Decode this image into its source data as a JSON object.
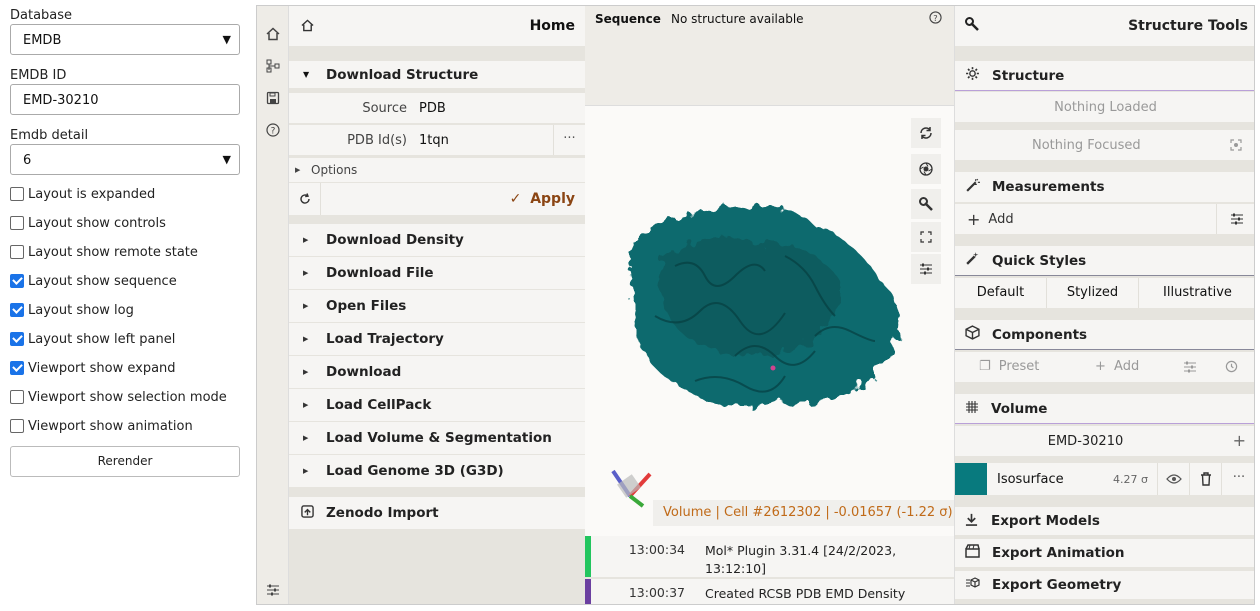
{
  "left": {
    "database_label": "Database",
    "database_value": "EMDB",
    "emdb_id_label": "EMDB ID",
    "emdb_id_value": "EMD-30210",
    "detail_label": "Emdb detail",
    "detail_value": "6",
    "checkboxes": [
      {
        "label": "Layout is expanded",
        "checked": false
      },
      {
        "label": "Layout show controls",
        "checked": false
      },
      {
        "label": "Layout show remote state",
        "checked": false
      },
      {
        "label": "Layout show sequence",
        "checked": true
      },
      {
        "label": "Layout show log",
        "checked": true
      },
      {
        "label": "Layout show left panel",
        "checked": true
      },
      {
        "label": "Viewport show expand",
        "checked": true
      },
      {
        "label": "Viewport show selection mode",
        "checked": false
      },
      {
        "label": "Viewport show animation",
        "checked": false
      }
    ],
    "rerender": "Rerender"
  },
  "home": {
    "title": "Home",
    "download_structure": "Download Structure",
    "source_label": "Source",
    "source_value": "PDB",
    "pdbid_label": "PDB Id(s)",
    "pdbid_value": "1tqn",
    "options": "Options",
    "apply": "Apply",
    "sections": [
      "Download Density",
      "Download File",
      "Open Files",
      "Load Trajectory",
      "Download",
      "Load CellPack",
      "Load Volume & Segmentation",
      "Load Genome 3D (G3D)"
    ],
    "zenodo": "Zenodo Import"
  },
  "sequence": {
    "label": "Sequence",
    "status": "No structure available"
  },
  "viewport": {
    "readout": "Volume | Cell #2612302 | -0.01657 (-1.22 σ)"
  },
  "log": [
    {
      "time": "13:00:34",
      "message": "Mol* Plugin 3.31.4 [24/2/2023, 13:12:10]",
      "color": "#22c55e"
    },
    {
      "time": "13:00:37",
      "message": "Created RCSB PDB EMD Density",
      "color": "#6b3fa0"
    }
  ],
  "tools": {
    "title": "Structure Tools",
    "structure": "Structure",
    "nothing_loaded": "Nothing Loaded",
    "nothing_focused": "Nothing Focused",
    "measurements": "Measurements",
    "add": "Add",
    "quick_styles": "Quick Styles",
    "styles": [
      "Default",
      "Stylized",
      "Illustrative"
    ],
    "components": "Components",
    "preset": "Preset",
    "add2": "Add",
    "volume": "Volume",
    "volume_name": "EMD-30210",
    "isosurface": "Isosurface",
    "iso_value": "4.27 σ",
    "iso_color": "#087a7e",
    "export_models": "Export Models",
    "export_animation": "Export Animation",
    "export_geometry": "Export Geometry"
  },
  "colors": {
    "accent": "#8b4513",
    "teal": "#0d6b6e",
    "readout": "#c06a18"
  }
}
